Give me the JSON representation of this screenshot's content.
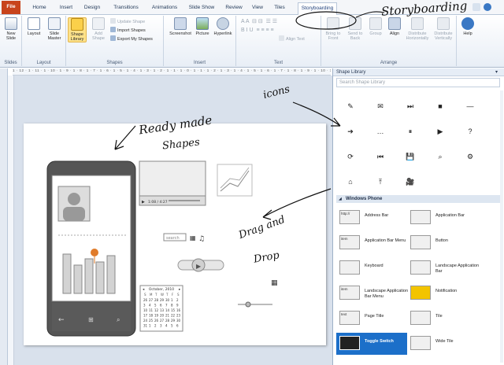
{
  "tabs": {
    "file": "File",
    "home": "Home",
    "insert": "Insert",
    "design": "Design",
    "transitions": "Transitions",
    "animations": "Animations",
    "slideshow": "Slide Show",
    "review": "Review",
    "view": "View",
    "tiles": "Tiles",
    "storyboarding": "Storyboarding"
  },
  "ribbon": {
    "slides": {
      "group": "Slides",
      "new_slide": "New Slide"
    },
    "layout": {
      "group": "Layout",
      "layout": "Layout",
      "slide_master": "Slide Master"
    },
    "shapes": {
      "group": "Shapes",
      "shape_library": "Shape Library",
      "add_shape": "Add Shape",
      "update_shape": "Update Shape",
      "import_shapes": "Import Shapes",
      "export_shapes": "Export My Shapes"
    },
    "insert": {
      "group": "Insert",
      "screenshot": "Screenshot",
      "picture": "Picture",
      "hyperlink": "Hyperlink"
    },
    "text": {
      "group": "Text",
      "align_text": "Align Text"
    },
    "arrange": {
      "group": "Arrange",
      "bring_front": "Bring to Front",
      "send_back": "Send to Back",
      "group_btn": "Group",
      "align": "Align",
      "dist_h": "Distribute Horizontally",
      "dist_v": "Distribute Vertically"
    },
    "help": "Help"
  },
  "ruler": "1 · 12 · 1 · 11 · 1 · 10 · 1 · 9 · 1 · 8 · 1 · 7 · 1 · 6 · 1 · 5 · 1 · 4 · 1 · 3 · 1 · 2 · 1 · 1 · 1 · 0 · 1 · 1 · 1 · 2 · 1 · 3 · 1 · 4 · 1 · 5 · 1 · 6 · 1 · 7 · 1 · 8 · 1 · 9 · 1 · 10 · 1 · 11 · 1 · 12",
  "slide": {
    "video_time": "1:08 / 4:27",
    "search_placeholder": "search",
    "calendar_title": "October, 2010",
    "calendar_days": [
      "S",
      "M",
      "T",
      "W",
      "T",
      "F",
      "S"
    ],
    "calendar_rows": [
      [
        "26",
        "27",
        "28",
        "29",
        "30",
        "1",
        "2"
      ],
      [
        "3",
        "4",
        "5",
        "6",
        "7",
        "8",
        "9"
      ],
      [
        "10",
        "11",
        "12",
        "13",
        "14",
        "15",
        "16"
      ],
      [
        "17",
        "18",
        "19",
        "20",
        "21",
        "22",
        "23"
      ],
      [
        "24",
        "25",
        "26",
        "27",
        "28",
        "29",
        "30"
      ],
      [
        "31",
        "1",
        "2",
        "3",
        "4",
        "5",
        "6"
      ]
    ]
  },
  "panel": {
    "title": "Shape Library",
    "search_placeholder": "Search Shape Library",
    "icons": [
      "✎",
      "✉",
      "⏭",
      "■",
      "—",
      "➔",
      "…",
      "⏸",
      "▶",
      "?",
      "⟳",
      "⏮",
      "💾",
      "⌕",
      "⚙",
      "⌂",
      "⤒",
      "🎥"
    ],
    "icon_names": [
      "pencil-icon",
      "mail-icon",
      "next-icon",
      "folder-icon",
      "minus-icon",
      "arrow-right-icon",
      "more-icon",
      "pause-icon",
      "play-icon",
      "help-icon",
      "refresh-icon",
      "previous-icon",
      "save-icon",
      "search-icon",
      "settings-icon",
      "home-icon",
      "upload-icon",
      "video-icon"
    ],
    "section": "Windows Phone",
    "controls": [
      {
        "label": "Address Bar",
        "thumb": "http://"
      },
      {
        "label": "Application Bar",
        "thumb": ""
      },
      {
        "label": "Application Bar Menu",
        "thumb": "item"
      },
      {
        "label": "Button",
        "thumb": ""
      },
      {
        "label": "Keyboard",
        "thumb": ""
      },
      {
        "label": "Landscape Application Bar",
        "thumb": ""
      },
      {
        "label": "Landscape Application Bar Menu",
        "thumb": "item"
      },
      {
        "label": "Notification",
        "thumb": ""
      },
      {
        "label": "Page Title",
        "thumb": "text"
      },
      {
        "label": "Tile",
        "thumb": ""
      },
      {
        "label": "Toggle Switch",
        "thumb": ""
      },
      {
        "label": "Wide Tile",
        "thumb": ""
      }
    ],
    "page_title_small": "MAP"
  },
  "annotations": {
    "storyboarding": "Storyboarding",
    "ready_made": "Ready made",
    "shapes": "Shapes",
    "icons": "icons",
    "drag": "Drag and",
    "drop": "Drop"
  },
  "colors": {
    "file_tab": "#c8441c",
    "selected_control": "#1c6fc9",
    "ribbon_selected": "#fde28a",
    "pin": "#e07b2a"
  }
}
